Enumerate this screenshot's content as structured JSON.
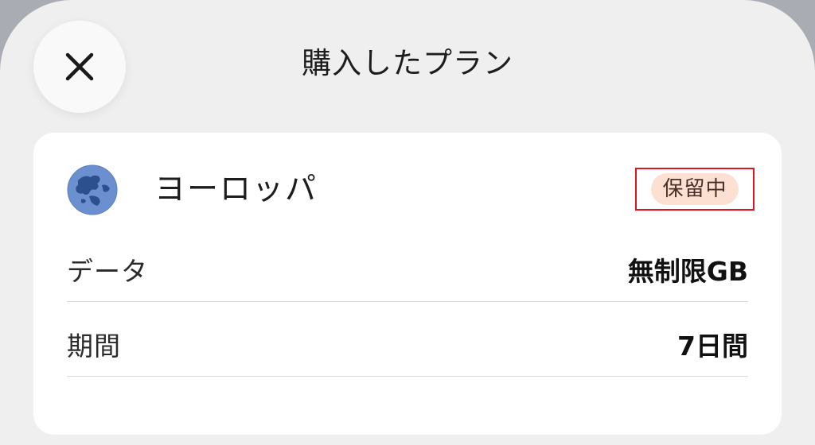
{
  "header": {
    "title": "購入したプラン",
    "close_icon": "close-icon"
  },
  "plan": {
    "name": "ヨーロッパ",
    "icon": "globe-europe-icon",
    "status": "保留中",
    "status_color": "#fce1d3"
  },
  "details": [
    {
      "label": "データ",
      "value": "無制限GB"
    },
    {
      "label": "期間",
      "value": "7日間"
    }
  ],
  "colors": {
    "background": "#efefef",
    "card": "#ffffff",
    "globe": "#6b8fcf",
    "highlight_border": "#e0141e"
  }
}
